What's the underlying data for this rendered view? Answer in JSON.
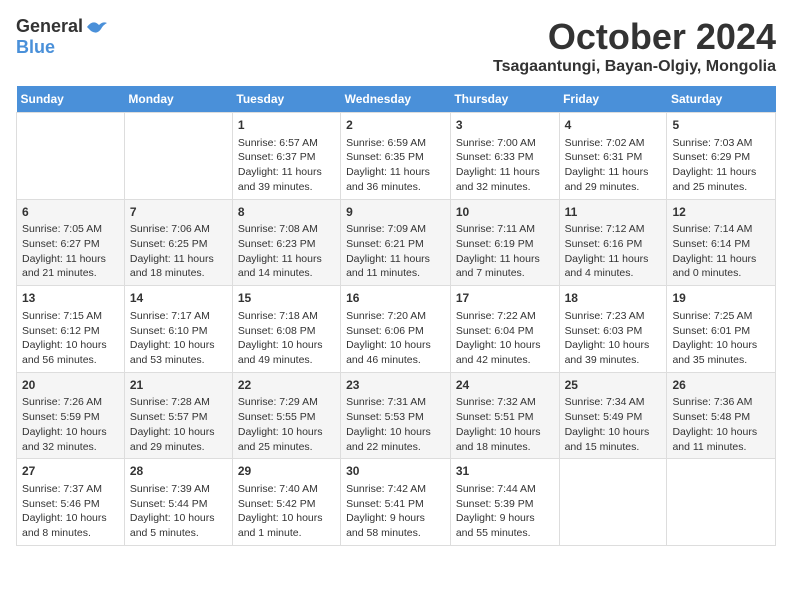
{
  "header": {
    "logo_general": "General",
    "logo_blue": "Blue",
    "month_title": "October 2024",
    "location": "Tsagaantungi, Bayan-Olgiy, Mongolia"
  },
  "days_of_week": [
    "Sunday",
    "Monday",
    "Tuesday",
    "Wednesday",
    "Thursday",
    "Friday",
    "Saturday"
  ],
  "weeks": [
    [
      {
        "day": "",
        "info": ""
      },
      {
        "day": "",
        "info": ""
      },
      {
        "day": "1",
        "info": "Sunrise: 6:57 AM\nSunset: 6:37 PM\nDaylight: 11 hours and 39 minutes."
      },
      {
        "day": "2",
        "info": "Sunrise: 6:59 AM\nSunset: 6:35 PM\nDaylight: 11 hours and 36 minutes."
      },
      {
        "day": "3",
        "info": "Sunrise: 7:00 AM\nSunset: 6:33 PM\nDaylight: 11 hours and 32 minutes."
      },
      {
        "day": "4",
        "info": "Sunrise: 7:02 AM\nSunset: 6:31 PM\nDaylight: 11 hours and 29 minutes."
      },
      {
        "day": "5",
        "info": "Sunrise: 7:03 AM\nSunset: 6:29 PM\nDaylight: 11 hours and 25 minutes."
      }
    ],
    [
      {
        "day": "6",
        "info": "Sunrise: 7:05 AM\nSunset: 6:27 PM\nDaylight: 11 hours and 21 minutes."
      },
      {
        "day": "7",
        "info": "Sunrise: 7:06 AM\nSunset: 6:25 PM\nDaylight: 11 hours and 18 minutes."
      },
      {
        "day": "8",
        "info": "Sunrise: 7:08 AM\nSunset: 6:23 PM\nDaylight: 11 hours and 14 minutes."
      },
      {
        "day": "9",
        "info": "Sunrise: 7:09 AM\nSunset: 6:21 PM\nDaylight: 11 hours and 11 minutes."
      },
      {
        "day": "10",
        "info": "Sunrise: 7:11 AM\nSunset: 6:19 PM\nDaylight: 11 hours and 7 minutes."
      },
      {
        "day": "11",
        "info": "Sunrise: 7:12 AM\nSunset: 6:16 PM\nDaylight: 11 hours and 4 minutes."
      },
      {
        "day": "12",
        "info": "Sunrise: 7:14 AM\nSunset: 6:14 PM\nDaylight: 11 hours and 0 minutes."
      }
    ],
    [
      {
        "day": "13",
        "info": "Sunrise: 7:15 AM\nSunset: 6:12 PM\nDaylight: 10 hours and 56 minutes."
      },
      {
        "day": "14",
        "info": "Sunrise: 7:17 AM\nSunset: 6:10 PM\nDaylight: 10 hours and 53 minutes."
      },
      {
        "day": "15",
        "info": "Sunrise: 7:18 AM\nSunset: 6:08 PM\nDaylight: 10 hours and 49 minutes."
      },
      {
        "day": "16",
        "info": "Sunrise: 7:20 AM\nSunset: 6:06 PM\nDaylight: 10 hours and 46 minutes."
      },
      {
        "day": "17",
        "info": "Sunrise: 7:22 AM\nSunset: 6:04 PM\nDaylight: 10 hours and 42 minutes."
      },
      {
        "day": "18",
        "info": "Sunrise: 7:23 AM\nSunset: 6:03 PM\nDaylight: 10 hours and 39 minutes."
      },
      {
        "day": "19",
        "info": "Sunrise: 7:25 AM\nSunset: 6:01 PM\nDaylight: 10 hours and 35 minutes."
      }
    ],
    [
      {
        "day": "20",
        "info": "Sunrise: 7:26 AM\nSunset: 5:59 PM\nDaylight: 10 hours and 32 minutes."
      },
      {
        "day": "21",
        "info": "Sunrise: 7:28 AM\nSunset: 5:57 PM\nDaylight: 10 hours and 29 minutes."
      },
      {
        "day": "22",
        "info": "Sunrise: 7:29 AM\nSunset: 5:55 PM\nDaylight: 10 hours and 25 minutes."
      },
      {
        "day": "23",
        "info": "Sunrise: 7:31 AM\nSunset: 5:53 PM\nDaylight: 10 hours and 22 minutes."
      },
      {
        "day": "24",
        "info": "Sunrise: 7:32 AM\nSunset: 5:51 PM\nDaylight: 10 hours and 18 minutes."
      },
      {
        "day": "25",
        "info": "Sunrise: 7:34 AM\nSunset: 5:49 PM\nDaylight: 10 hours and 15 minutes."
      },
      {
        "day": "26",
        "info": "Sunrise: 7:36 AM\nSunset: 5:48 PM\nDaylight: 10 hours and 11 minutes."
      }
    ],
    [
      {
        "day": "27",
        "info": "Sunrise: 7:37 AM\nSunset: 5:46 PM\nDaylight: 10 hours and 8 minutes."
      },
      {
        "day": "28",
        "info": "Sunrise: 7:39 AM\nSunset: 5:44 PM\nDaylight: 10 hours and 5 minutes."
      },
      {
        "day": "29",
        "info": "Sunrise: 7:40 AM\nSunset: 5:42 PM\nDaylight: 10 hours and 1 minute."
      },
      {
        "day": "30",
        "info": "Sunrise: 7:42 AM\nSunset: 5:41 PM\nDaylight: 9 hours and 58 minutes."
      },
      {
        "day": "31",
        "info": "Sunrise: 7:44 AM\nSunset: 5:39 PM\nDaylight: 9 hours and 55 minutes."
      },
      {
        "day": "",
        "info": ""
      },
      {
        "day": "",
        "info": ""
      }
    ]
  ]
}
